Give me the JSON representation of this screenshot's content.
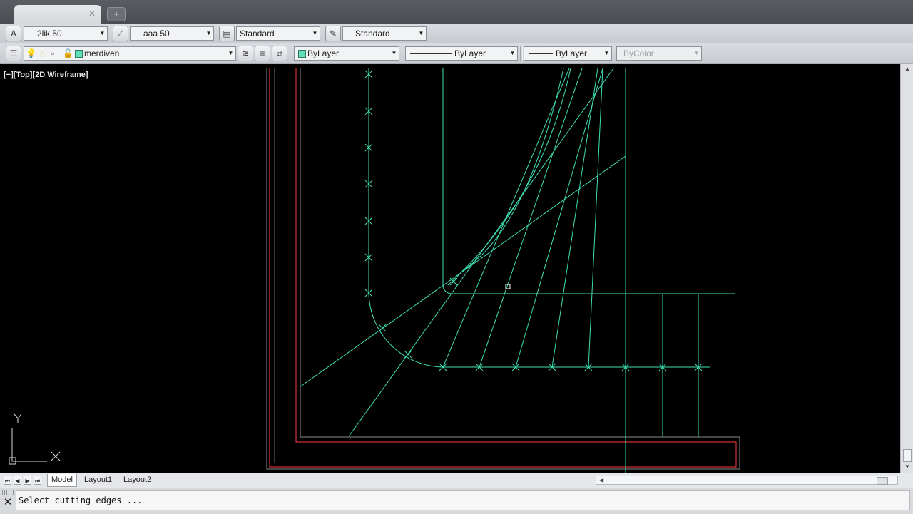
{
  "toolbar1": {
    "text_style": "2lik 50",
    "dim_style": "aaa 50",
    "table_style": "Standard",
    "mleader_style": "Standard"
  },
  "toolbar2": {
    "layer": "merdiven",
    "color": "ByLayer",
    "linetype": "ByLayer",
    "lineweight": "ByLayer",
    "plot_style": "ByColor"
  },
  "viewport": {
    "label": "[−][Top][2D Wireframe]",
    "ucs_x": "X",
    "ucs_y": "Y"
  },
  "layout_tabs": [
    "Model",
    "Layout1",
    "Layout2"
  ],
  "command": {
    "prompt": "Select cutting edges ..."
  },
  "colors": {
    "geometry": "#40e0b4",
    "border": "#ff3c3c",
    "inner": "#8c8c8c",
    "background": "#000000"
  }
}
